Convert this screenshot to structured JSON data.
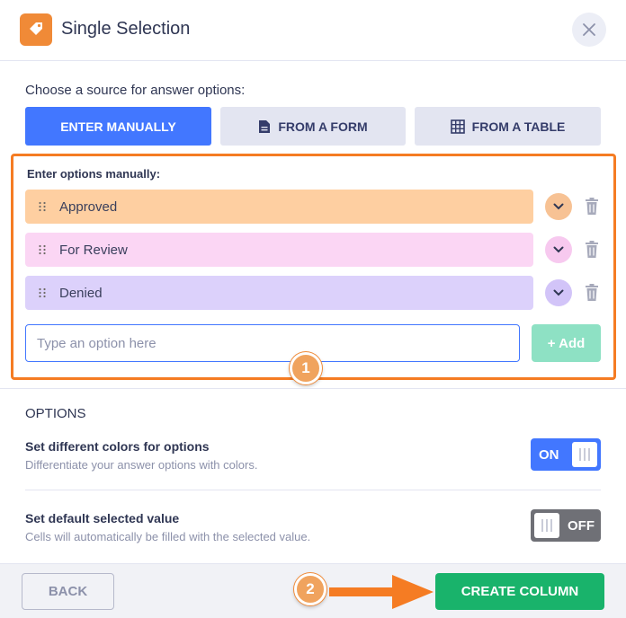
{
  "header": {
    "title": "Single Selection",
    "icon": "tag-icon",
    "accent_color": "#f08a37"
  },
  "source": {
    "label": "Choose a source for answer options:",
    "buttons": [
      {
        "label": "ENTER MANUALLY",
        "icon": "",
        "active": true
      },
      {
        "label": "FROM A FORM",
        "icon": "document-icon",
        "active": false
      },
      {
        "label": "FROM A TABLE",
        "icon": "table-grid-icon",
        "active": false
      }
    ]
  },
  "manual": {
    "label": "Enter options manually:",
    "options": [
      {
        "label": "Approved",
        "color": "#fecfa1",
        "chevron_color": "#f7c294"
      },
      {
        "label": "For Review",
        "color": "#fbd6f4",
        "chevron_color": "#f7c9ef"
      },
      {
        "label": "Denied",
        "color": "#dcd1fb",
        "chevron_color": "#d2c4f8"
      }
    ],
    "input_placeholder": "Type an option here",
    "input_value": "",
    "add_label": "+ Add"
  },
  "steps": {
    "one": "1",
    "two": "2"
  },
  "options": {
    "title": "OPTIONS",
    "colors": {
      "title": "Set different colors for options",
      "desc": "Differentiate your answer options with colors.",
      "toggle": "ON",
      "enabled": true
    },
    "default_value": {
      "title": "Set default selected value",
      "desc": "Cells will automatically be filled with the selected value.",
      "toggle": "OFF",
      "enabled": false
    }
  },
  "footer": {
    "back_label": "BACK",
    "create_label": "CREATE COLUMN"
  }
}
